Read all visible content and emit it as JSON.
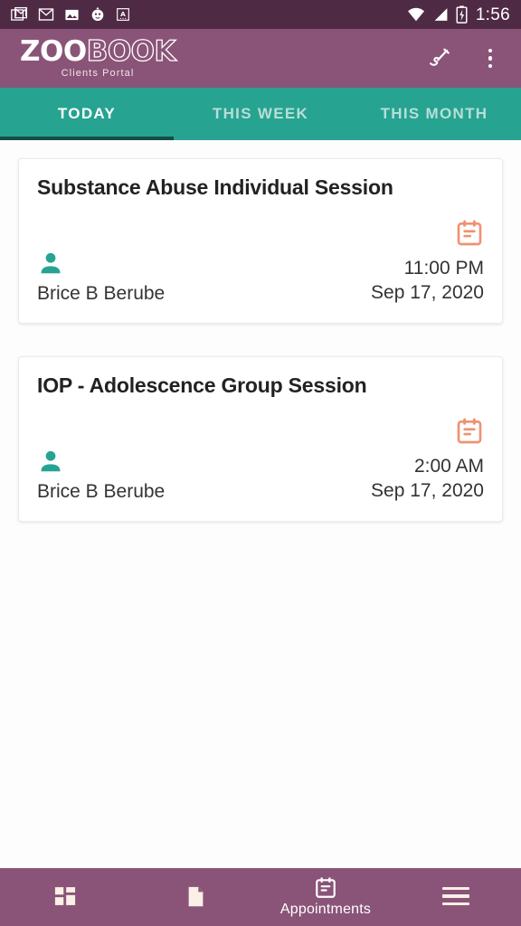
{
  "status_bar": {
    "time": "1:56",
    "left_icons": [
      "gmail-stacked-icon",
      "gmail-icon",
      "image-icon",
      "avatar-emoji-icon",
      "text-a-icon"
    ],
    "right_icons": [
      "wifi-icon",
      "cell-signal-icon",
      "battery-charging-icon"
    ],
    "background": "#4f2a45"
  },
  "app_bar": {
    "logo_primary": "ZOO",
    "logo_secondary": "BOOK",
    "logo_subtitle": "Clients Portal",
    "background": "#8a5478",
    "actions": [
      {
        "name": "signature-pen-icon",
        "label": "Sign"
      },
      {
        "name": "overflow-menu-icon",
        "label": "More options"
      }
    ]
  },
  "tabs": {
    "active_index": 0,
    "accent": "#27a391",
    "indicator_color": "#134d48",
    "items": [
      {
        "label": "TODAY"
      },
      {
        "label": "THIS WEEK"
      },
      {
        "label": "THIS MONTH"
      }
    ]
  },
  "appointments": [
    {
      "title": "Substance Abuse Individual Session",
      "client": "Brice B Berube",
      "time": "11:00 PM",
      "date": "Sep 17, 2020"
    },
    {
      "title": "IOP - Adolescence Group Session",
      "client": "Brice B Berube",
      "time": "2:00 AM",
      "date": "Sep 17, 2020"
    }
  ],
  "icon_colors": {
    "person": "#27a391",
    "calendar": "#ef9272"
  },
  "bottom_nav": {
    "background": "#8a5478",
    "active_index": 2,
    "items": [
      {
        "icon": "dashboard-grid-icon",
        "label": ""
      },
      {
        "icon": "document-icon",
        "label": ""
      },
      {
        "icon": "calendar-icon",
        "label": "Appointments"
      },
      {
        "icon": "hamburger-menu-icon",
        "label": ""
      }
    ]
  }
}
